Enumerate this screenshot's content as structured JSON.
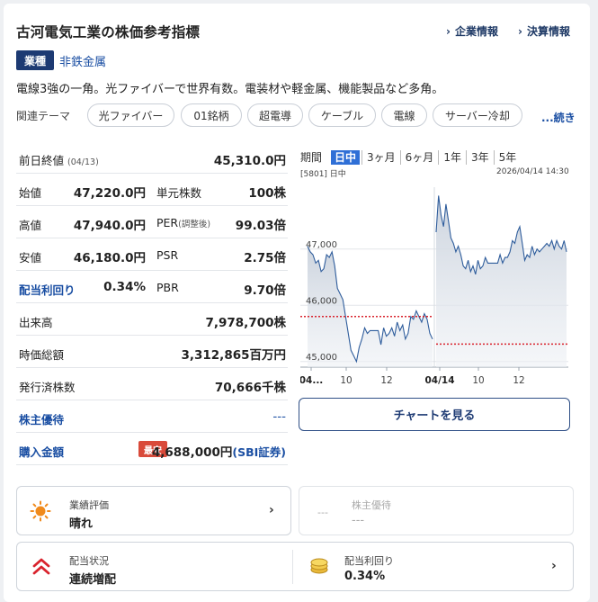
{
  "header": {
    "title": "古河電気工業の株価参考指標",
    "links": [
      "企業情報",
      "決算情報"
    ]
  },
  "sector": {
    "badge": "業種",
    "name": "非鉄金属"
  },
  "description": "電線3強の一角。光ファイバーで世界有数。電装材や軽金属、機能製品など多角。",
  "themes": {
    "label": "関連テーマ",
    "items": [
      "光ファイバー",
      "01銘柄",
      "超電導",
      "ケーブル",
      "電線",
      "サーバー冷却"
    ],
    "more": "...続き"
  },
  "metrics": {
    "prev_close": {
      "label": "前日終値",
      "date": "(04/13)",
      "value": "45,310.0円"
    },
    "open": {
      "label": "始値",
      "value": "47,220.0円"
    },
    "unit": {
      "label": "単元株数",
      "value": "100株"
    },
    "high": {
      "label": "高値",
      "value": "47,940.0円"
    },
    "per": {
      "label": "PER",
      "sub": "(調整後)",
      "value": "99.03倍"
    },
    "low": {
      "label": "安値",
      "value": "46,180.0円"
    },
    "psr": {
      "label": "PSR",
      "value": "2.75倍"
    },
    "yield": {
      "label": "配当利回り",
      "value": "0.34%"
    },
    "pbr": {
      "label": "PBR",
      "value": "9.70倍"
    },
    "volume": {
      "label": "出来高",
      "value": "7,978,700株"
    },
    "market_cap": {
      "label": "時価総額",
      "value": "3,312,865百万円"
    },
    "shares": {
      "label": "発行済株数",
      "value": "70,666千株"
    },
    "benefit": {
      "label": "株主優待",
      "value": "---"
    },
    "purchase": {
      "label": "購入金額",
      "badge": "最安",
      "value": "4,688,000円",
      "broker": "(SBI証券)"
    }
  },
  "chart": {
    "periods": [
      "期間",
      "日中",
      "3ヶ月",
      "6ヶ月",
      "1年",
      "3年",
      "5年"
    ],
    "active_period": "日中",
    "code": "[5801] 日中",
    "timestamp": "2026/04/14 14:30",
    "button": "チャートを見る"
  },
  "chart_data": {
    "type": "area",
    "x_ticks": [
      "04...",
      "10",
      "12",
      "04/14",
      "10",
      "12"
    ],
    "y_ticks": [
      "47,000",
      "46,000",
      "45,000"
    ],
    "ylim": [
      44900,
      48100
    ],
    "prev_close_day1": 45800,
    "prev_close_day2": 45310,
    "day1": [
      47050,
      46950,
      46900,
      46750,
      46800,
      46600,
      46650,
      46900,
      46850,
      46950,
      46700,
      46300,
      46200,
      46100,
      45800,
      45500,
      45200,
      45100,
      45000,
      45250,
      45400,
      45600,
      45500,
      45550,
      45550,
      45550,
      45550,
      45300,
      45600,
      45450,
      45500,
      45600,
      45450,
      45700,
      45550,
      45650,
      45400,
      45500,
      45800,
      45750,
      45900,
      45800,
      45700,
      45850,
      45750,
      45500,
      45400
    ],
    "day2": [
      47300,
      47950,
      47600,
      47400,
      47800,
      47500,
      47200,
      47100,
      46950,
      47050,
      46900,
      46700,
      46650,
      46800,
      46600,
      46700,
      46550,
      46800,
      46650,
      46700,
      46850,
      46750,
      46750,
      46750,
      46750,
      46750,
      46900,
      46750,
      46850,
      46850,
      46950,
      47150,
      47100,
      47300,
      47400,
      47100,
      46800,
      46900,
      46850,
      47050,
      46900,
      47000,
      46950,
      47000,
      47050,
      47100,
      47050,
      47150,
      47000,
      47150,
      47050,
      47000,
      47150,
      46950
    ]
  },
  "tiles": {
    "rating": {
      "label": "業績評価",
      "value": "晴れ"
    },
    "benefit": {
      "label": "株主優待",
      "value": "---",
      "icon_text": "---"
    },
    "dividend": {
      "label": "配当状況",
      "value": "連続増配"
    },
    "dividend_yield": {
      "label": "配当利回り",
      "value": "0.34%"
    }
  },
  "colors": {
    "navy": "#1d3a73",
    "link": "#1b4fa3",
    "accent": "#2f6fd6",
    "red": "#d9232d",
    "line": "#2f5d9c",
    "area": "#c9d1dc"
  }
}
